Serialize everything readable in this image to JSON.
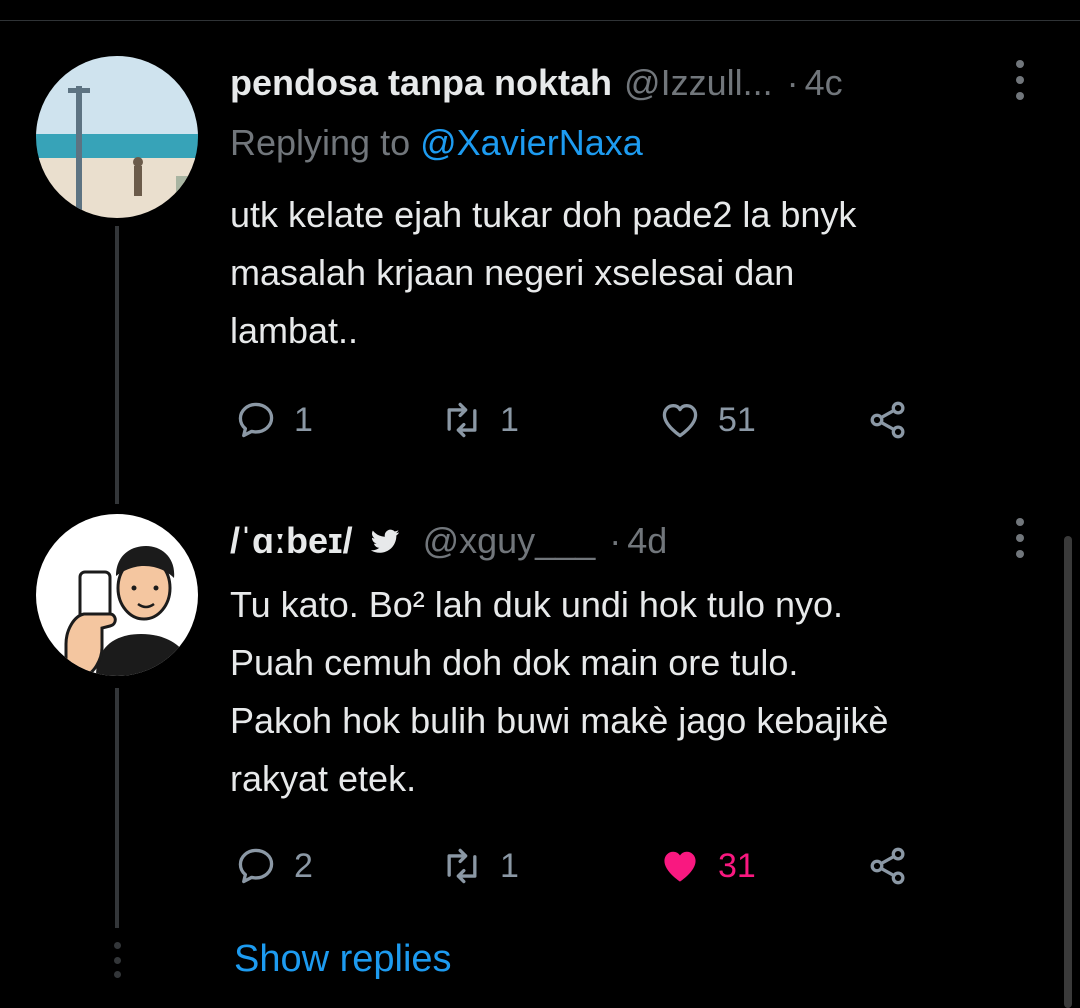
{
  "tweets": [
    {
      "name": "pendosa tanpa noktah",
      "handle": "@Izzull...",
      "time": "4c",
      "replying_prefix": "Replying to",
      "replying_to": "@XavierNaxa",
      "text": "utk kelate ejah tukar doh pade2 la bnyk\nmasalah krjaan negeri xselesai dan\nlambat..",
      "replies": "1",
      "retweets": "1",
      "likes": "51",
      "liked": false
    },
    {
      "name": "/ˈɑːbeɪ/",
      "handle": "@xguy___",
      "time": "4d",
      "text": "Tu kato. Bo² lah duk undi hok tulo nyo.\nPuah cemuh doh dok main ore tulo.\nPakoh hok bulih buwi makè jago kebajikè\nrakyat etek.",
      "replies": "2",
      "retweets": "1",
      "likes": "31",
      "liked": true
    }
  ],
  "show_replies": "Show replies",
  "colors": {
    "background": "#000000",
    "text": "#e7e9ea",
    "secondary": "#71767b",
    "accent": "#1d9bf0",
    "like": "#f91880"
  },
  "icons": {
    "reply": "reply-icon",
    "retweet": "retweet-icon",
    "like": "heart-icon",
    "share": "share-icon",
    "more": "more-icon",
    "bird": "bird-icon"
  }
}
